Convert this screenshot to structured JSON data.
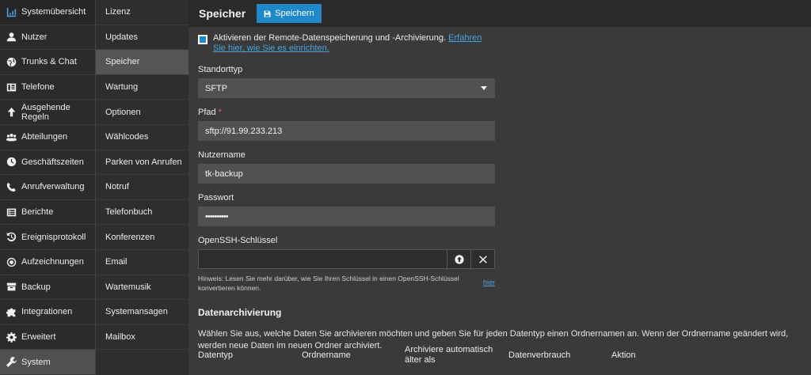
{
  "nav_primary": [
    {
      "label": "Systemübersicht",
      "icon": "dashboard-icon"
    },
    {
      "label": "Nutzer",
      "icon": "user-icon"
    },
    {
      "label": "Trunks & Chat",
      "icon": "globe-icon"
    },
    {
      "label": "Telefone",
      "icon": "phone-book-icon"
    },
    {
      "label": "Ausgehende Regeln",
      "icon": "arrow-up-icon"
    },
    {
      "label": "Abteilungen",
      "icon": "group-icon"
    },
    {
      "label": "Geschäftszeiten",
      "icon": "clock-icon"
    },
    {
      "label": "Anrufverwaltung",
      "icon": "phone-icon"
    },
    {
      "label": "Berichte",
      "icon": "report-icon"
    },
    {
      "label": "Ereignisprotokoll",
      "icon": "history-icon"
    },
    {
      "label": "Aufzeichnungen",
      "icon": "record-icon"
    },
    {
      "label": "Backup",
      "icon": "archive-icon"
    },
    {
      "label": "Integrationen",
      "icon": "puzzle-icon"
    },
    {
      "label": "Erweitert",
      "icon": "gear-icon"
    },
    {
      "label": "System",
      "icon": "wrench-icon"
    }
  ],
  "nav_secondary": [
    "Lizenz",
    "Updates",
    "Speicher",
    "Wartung",
    "Optionen",
    "Wählcodes",
    "Parken von Anrufen",
    "Notruf",
    "Telefonbuch",
    "Konferenzen",
    "Email",
    "Wartemusik",
    "Systemansagen",
    "Mailbox"
  ],
  "header": {
    "title": "Speicher",
    "save_label": "Speichern"
  },
  "enable": {
    "text": "Aktivieren der Remote-Datenspeicherung und -Archivierung.",
    "link": "Erfahren Sie hier, wie Sie es einrichten."
  },
  "form": {
    "storage_type_label": "Standorttyp",
    "storage_type_value": "SFTP",
    "path_label": "Pfad",
    "path_required": "*",
    "path_value": "sftp://91.99.233.213",
    "username_label": "Nutzername",
    "username_value": "tk-backup",
    "password_label": "Passwort",
    "password_value": "••••••••••",
    "ssh_label": "OpenSSH-Schlüssel",
    "ssh_value": "",
    "hint": "Hinweis: Lesen Sie mehr darüber, wie Sie Ihren Schlüssel in einen OpenSSH-Schlüssel konvertieren können.",
    "hint_link": "hier"
  },
  "archive": {
    "title": "Datenarchivierung",
    "description": "Wählen Sie aus, welche Daten Sie archivieren möchten und geben Sie für jeden Datentyp einen Ordnernamen an. Wenn der Ordnername geändert wird, werden neue Daten im neuen Ordner archiviert.",
    "columns": [
      "Datentyp",
      "Ordnername",
      "Archiviere automatisch älter als",
      "Datenverbrauch",
      "Aktion"
    ]
  },
  "colors": {
    "accent": "#1e88c9",
    "link": "#4aa3df"
  }
}
